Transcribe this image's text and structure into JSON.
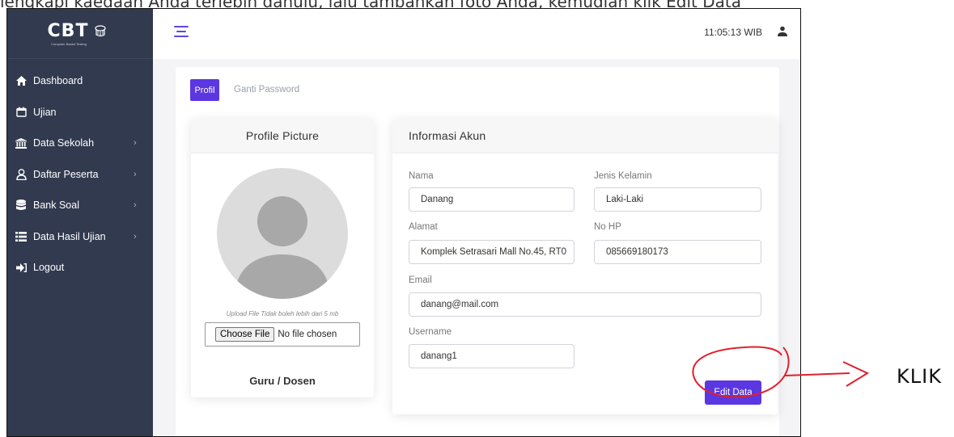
{
  "doc_caption": "lengkapi kaedaan Anda terlebih dahulu, lalu tambahkan foto Anda, kemudian klik Edit Data",
  "app": {
    "logo": "CBT",
    "logo_sub": "Computer Based Testing"
  },
  "sidebar": {
    "items": [
      {
        "label": "Dashboard",
        "icon": "home-icon",
        "has_chevron": false
      },
      {
        "label": "Ujian",
        "icon": "calendar-icon",
        "has_chevron": false
      },
      {
        "label": "Data Sekolah",
        "icon": "school-icon",
        "has_chevron": true
      },
      {
        "label": "Daftar Peserta",
        "icon": "user-outline-icon",
        "has_chevron": true
      },
      {
        "label": "Bank Soal",
        "icon": "database-icon",
        "has_chevron": true
      },
      {
        "label": "Data Hasil Ujian",
        "icon": "list-icon",
        "has_chevron": true
      },
      {
        "label": "Logout",
        "icon": "logout-icon",
        "has_chevron": false
      }
    ]
  },
  "header": {
    "time": "11:05:13 WIB"
  },
  "tabs": {
    "profil": "Profil",
    "password": "Ganti Password"
  },
  "profile_card": {
    "title": "Profile Picture",
    "upload_note": "Upload File Tidak boleh lebih dari 5 mb",
    "choose_file": "Choose File",
    "no_file": "No file chosen",
    "role": "Guru / Dosen"
  },
  "info_card": {
    "title": "Informasi Akun",
    "nama_label": "Nama",
    "nama_value": "Danang",
    "jk_label": "Jenis Kelamin",
    "jk_value": "Laki-Laki",
    "alamat_label": "Alamat",
    "alamat_value": "Komplek Setrasari Mall No.45, RT0",
    "hp_label": "No HP",
    "hp_value": "085669180173",
    "email_label": "Email",
    "email_value": "danang@mail.com",
    "username_label": "Username",
    "username_value": "danang1",
    "edit_button": "Edit Data"
  },
  "annotation": {
    "text": "KLIK",
    "color": "#e0202c"
  },
  "colors": {
    "sidebar": "#323a4f",
    "accent": "#5b37e2"
  }
}
